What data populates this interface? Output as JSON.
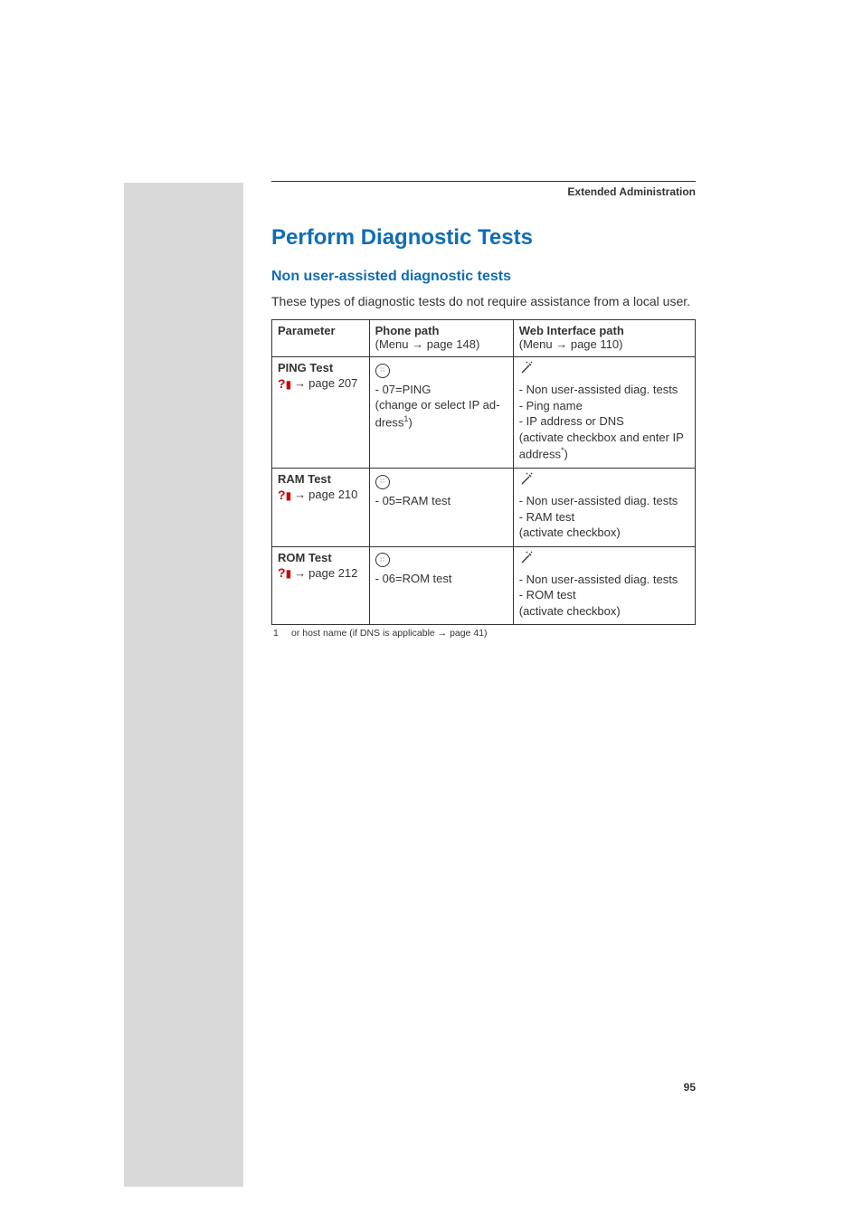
{
  "header": {
    "title": "Extended Administration"
  },
  "section": {
    "heading": "Perform Diagnostic Tests",
    "subheading": "Non user-assisted diagnostic tests",
    "intro": "These types of diagnostic tests do not require assistance from a local user."
  },
  "table": {
    "headers": {
      "param": "Parameter",
      "phone_title": "Phone path",
      "phone_menu_prefix": "(Menu",
      "phone_menu_page": "page 148)",
      "web_title": "Web Interface path",
      "web_menu_prefix": "(Menu",
      "web_menu_page": "page 110)"
    },
    "rows": [
      {
        "param_name": "PING Test",
        "param_page": "page 207",
        "phone": {
          "lines": [
            "- 07=PING",
            "(change or select IP ad-",
            "dress"
          ],
          "footnote_marker": "1",
          "suffix": ")"
        },
        "web": {
          "lines": [
            "- Non user-assisted diag. tests",
            "- Ping name",
            "- IP address or DNS",
            "(activate checkbox and enter IP",
            "address"
          ],
          "footnote_marker": "*",
          "suffix": ")"
        }
      },
      {
        "param_name": "RAM Test",
        "param_page": "page 210",
        "phone": {
          "lines": [
            "- 05=RAM test"
          ]
        },
        "web": {
          "lines": [
            "- Non user-assisted diag. tests",
            "- RAM test",
            "(activate checkbox)"
          ]
        }
      },
      {
        "param_name": "ROM Test",
        "param_page": "page 212",
        "phone": {
          "lines": [
            "- 06=ROM test"
          ]
        },
        "web": {
          "lines": [
            "- Non user-assisted diag. tests",
            "- ROM test",
            "(activate checkbox)"
          ]
        }
      }
    ]
  },
  "footnote": {
    "num": "1",
    "text_before": "or host name (if DNS is applicable",
    "text_after": "page 41)"
  },
  "arrow_glyph": "→",
  "page_number": "95"
}
